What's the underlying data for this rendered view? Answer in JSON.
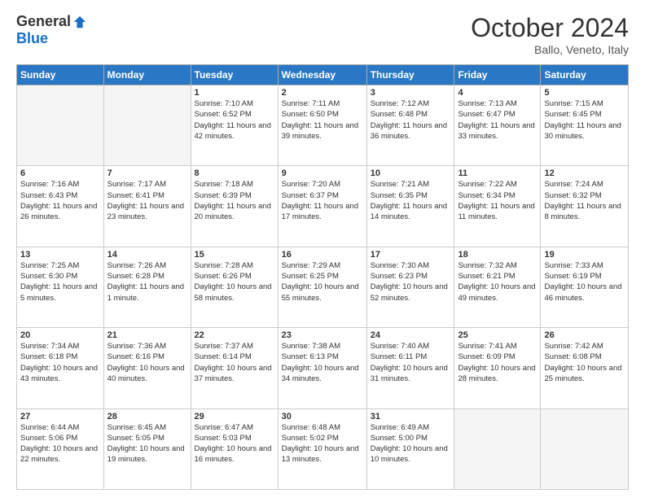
{
  "header": {
    "logo_general": "General",
    "logo_blue": "Blue",
    "month_title": "October 2024",
    "location": "Ballo, Veneto, Italy"
  },
  "weekdays": [
    "Sunday",
    "Monday",
    "Tuesday",
    "Wednesday",
    "Thursday",
    "Friday",
    "Saturday"
  ],
  "weeks": [
    [
      {
        "day": "",
        "sunrise": "",
        "sunset": "",
        "daylight": ""
      },
      {
        "day": "",
        "sunrise": "",
        "sunset": "",
        "daylight": ""
      },
      {
        "day": "1",
        "sunrise": "Sunrise: 7:10 AM",
        "sunset": "Sunset: 6:52 PM",
        "daylight": "Daylight: 11 hours and 42 minutes."
      },
      {
        "day": "2",
        "sunrise": "Sunrise: 7:11 AM",
        "sunset": "Sunset: 6:50 PM",
        "daylight": "Daylight: 11 hours and 39 minutes."
      },
      {
        "day": "3",
        "sunrise": "Sunrise: 7:12 AM",
        "sunset": "Sunset: 6:48 PM",
        "daylight": "Daylight: 11 hours and 36 minutes."
      },
      {
        "day": "4",
        "sunrise": "Sunrise: 7:13 AM",
        "sunset": "Sunset: 6:47 PM",
        "daylight": "Daylight: 11 hours and 33 minutes."
      },
      {
        "day": "5",
        "sunrise": "Sunrise: 7:15 AM",
        "sunset": "Sunset: 6:45 PM",
        "daylight": "Daylight: 11 hours and 30 minutes."
      }
    ],
    [
      {
        "day": "6",
        "sunrise": "Sunrise: 7:16 AM",
        "sunset": "Sunset: 6:43 PM",
        "daylight": "Daylight: 11 hours and 26 minutes."
      },
      {
        "day": "7",
        "sunrise": "Sunrise: 7:17 AM",
        "sunset": "Sunset: 6:41 PM",
        "daylight": "Daylight: 11 hours and 23 minutes."
      },
      {
        "day": "8",
        "sunrise": "Sunrise: 7:18 AM",
        "sunset": "Sunset: 6:39 PM",
        "daylight": "Daylight: 11 hours and 20 minutes."
      },
      {
        "day": "9",
        "sunrise": "Sunrise: 7:20 AM",
        "sunset": "Sunset: 6:37 PM",
        "daylight": "Daylight: 11 hours and 17 minutes."
      },
      {
        "day": "10",
        "sunrise": "Sunrise: 7:21 AM",
        "sunset": "Sunset: 6:35 PM",
        "daylight": "Daylight: 11 hours and 14 minutes."
      },
      {
        "day": "11",
        "sunrise": "Sunrise: 7:22 AM",
        "sunset": "Sunset: 6:34 PM",
        "daylight": "Daylight: 11 hours and 11 minutes."
      },
      {
        "day": "12",
        "sunrise": "Sunrise: 7:24 AM",
        "sunset": "Sunset: 6:32 PM",
        "daylight": "Daylight: 11 hours and 8 minutes."
      }
    ],
    [
      {
        "day": "13",
        "sunrise": "Sunrise: 7:25 AM",
        "sunset": "Sunset: 6:30 PM",
        "daylight": "Daylight: 11 hours and 5 minutes."
      },
      {
        "day": "14",
        "sunrise": "Sunrise: 7:26 AM",
        "sunset": "Sunset: 6:28 PM",
        "daylight": "Daylight: 11 hours and 1 minute."
      },
      {
        "day": "15",
        "sunrise": "Sunrise: 7:28 AM",
        "sunset": "Sunset: 6:26 PM",
        "daylight": "Daylight: 10 hours and 58 minutes."
      },
      {
        "day": "16",
        "sunrise": "Sunrise: 7:29 AM",
        "sunset": "Sunset: 6:25 PM",
        "daylight": "Daylight: 10 hours and 55 minutes."
      },
      {
        "day": "17",
        "sunrise": "Sunrise: 7:30 AM",
        "sunset": "Sunset: 6:23 PM",
        "daylight": "Daylight: 10 hours and 52 minutes."
      },
      {
        "day": "18",
        "sunrise": "Sunrise: 7:32 AM",
        "sunset": "Sunset: 6:21 PM",
        "daylight": "Daylight: 10 hours and 49 minutes."
      },
      {
        "day": "19",
        "sunrise": "Sunrise: 7:33 AM",
        "sunset": "Sunset: 6:19 PM",
        "daylight": "Daylight: 10 hours and 46 minutes."
      }
    ],
    [
      {
        "day": "20",
        "sunrise": "Sunrise: 7:34 AM",
        "sunset": "Sunset: 6:18 PM",
        "daylight": "Daylight: 10 hours and 43 minutes."
      },
      {
        "day": "21",
        "sunrise": "Sunrise: 7:36 AM",
        "sunset": "Sunset: 6:16 PM",
        "daylight": "Daylight: 10 hours and 40 minutes."
      },
      {
        "day": "22",
        "sunrise": "Sunrise: 7:37 AM",
        "sunset": "Sunset: 6:14 PM",
        "daylight": "Daylight: 10 hours and 37 minutes."
      },
      {
        "day": "23",
        "sunrise": "Sunrise: 7:38 AM",
        "sunset": "Sunset: 6:13 PM",
        "daylight": "Daylight: 10 hours and 34 minutes."
      },
      {
        "day": "24",
        "sunrise": "Sunrise: 7:40 AM",
        "sunset": "Sunset: 6:11 PM",
        "daylight": "Daylight: 10 hours and 31 minutes."
      },
      {
        "day": "25",
        "sunrise": "Sunrise: 7:41 AM",
        "sunset": "Sunset: 6:09 PM",
        "daylight": "Daylight: 10 hours and 28 minutes."
      },
      {
        "day": "26",
        "sunrise": "Sunrise: 7:42 AM",
        "sunset": "Sunset: 6:08 PM",
        "daylight": "Daylight: 10 hours and 25 minutes."
      }
    ],
    [
      {
        "day": "27",
        "sunrise": "Sunrise: 6:44 AM",
        "sunset": "Sunset: 5:06 PM",
        "daylight": "Daylight: 10 hours and 22 minutes."
      },
      {
        "day": "28",
        "sunrise": "Sunrise: 6:45 AM",
        "sunset": "Sunset: 5:05 PM",
        "daylight": "Daylight: 10 hours and 19 minutes."
      },
      {
        "day": "29",
        "sunrise": "Sunrise: 6:47 AM",
        "sunset": "Sunset: 5:03 PM",
        "daylight": "Daylight: 10 hours and 16 minutes."
      },
      {
        "day": "30",
        "sunrise": "Sunrise: 6:48 AM",
        "sunset": "Sunset: 5:02 PM",
        "daylight": "Daylight: 10 hours and 13 minutes."
      },
      {
        "day": "31",
        "sunrise": "Sunrise: 6:49 AM",
        "sunset": "Sunset: 5:00 PM",
        "daylight": "Daylight: 10 hours and 10 minutes."
      },
      {
        "day": "",
        "sunrise": "",
        "sunset": "",
        "daylight": ""
      },
      {
        "day": "",
        "sunrise": "",
        "sunset": "",
        "daylight": ""
      }
    ]
  ]
}
